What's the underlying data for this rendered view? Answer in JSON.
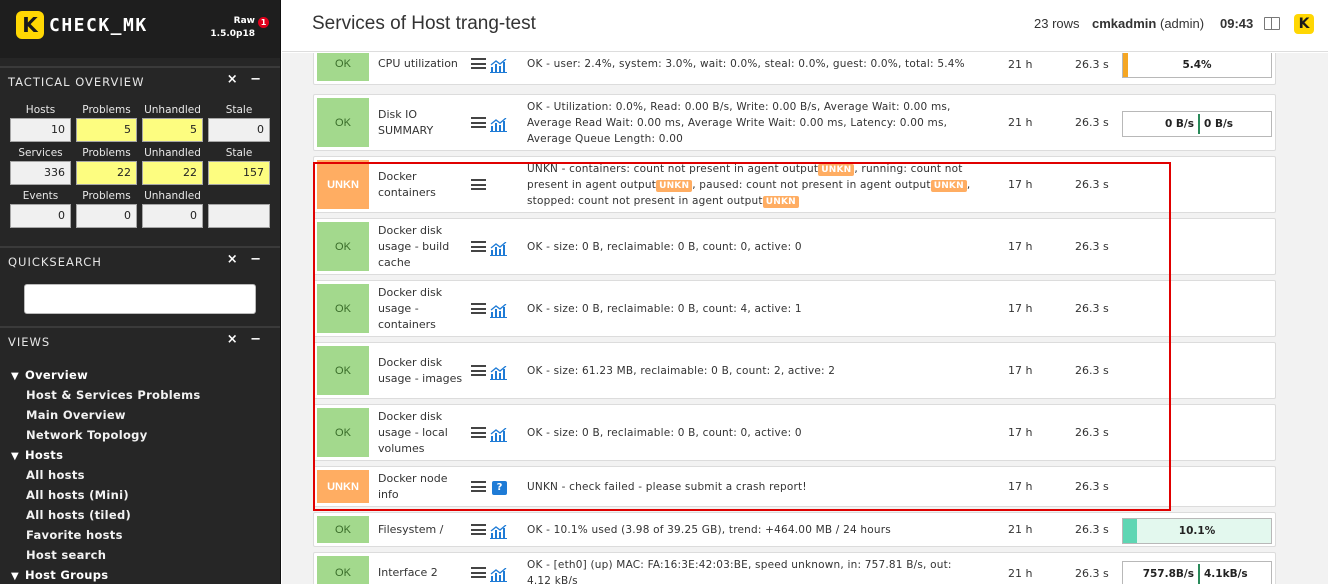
{
  "brand": {
    "logo_letter": "K",
    "name": "CHECK_MK",
    "edition": "Raw",
    "version": "1.5.0p18",
    "badge": "1"
  },
  "tactical": {
    "title": "TACTICAL OVERVIEW",
    "controls": "× −",
    "rows": [
      {
        "headers": [
          "Hosts",
          "Problems",
          "Unhandled",
          "Stale"
        ],
        "values": [
          "10",
          "5",
          "5",
          "0"
        ]
      },
      {
        "headers": [
          "Services",
          "Problems",
          "Unhandled",
          "Stale"
        ],
        "values": [
          "336",
          "22",
          "22",
          "157"
        ]
      },
      {
        "headers": [
          "Events",
          "Problems",
          "Unhandled",
          ""
        ],
        "values": [
          "0",
          "0",
          "0",
          ""
        ]
      }
    ]
  },
  "quicksearch": {
    "title": "QUICKSEARCH",
    "controls": "× −",
    "value": ""
  },
  "views": {
    "title": "VIEWS",
    "controls": "× −",
    "items": [
      {
        "label": "Overview",
        "level": "top"
      },
      {
        "label": "Host & Services Problems",
        "level": "sub"
      },
      {
        "label": "Main Overview",
        "level": "sub"
      },
      {
        "label": "Network Topology",
        "level": "sub"
      },
      {
        "label": "Hosts",
        "level": "top"
      },
      {
        "label": "All hosts",
        "level": "sub"
      },
      {
        "label": "All hosts (Mini)",
        "level": "sub"
      },
      {
        "label": "All hosts (tiled)",
        "level": "sub"
      },
      {
        "label": "Favorite hosts",
        "level": "sub"
      },
      {
        "label": "Host search",
        "level": "sub"
      },
      {
        "label": "Host Groups",
        "level": "top"
      }
    ]
  },
  "header": {
    "title": "Services of Host trang-test",
    "rows": "23 rows",
    "user": "cmkadmin",
    "role": "(admin)",
    "time": "09:43"
  },
  "services": [
    {
      "state": "OK",
      "name": "CPU utilization",
      "output": "OK - user: 2.4%, system: 3.0%, wait: 0.0%, steal: 0.0%, guest: 0.0%, total: 5.4%",
      "age": "21 h",
      "check": "26.3 s",
      "perf": "5.4%",
      "perf_pct": 5.4,
      "icon": "graph"
    },
    {
      "state": "OK",
      "name": "Disk IO SUMMARY",
      "output": "OK - Utilization: 0.0%, Read: 0.00 B/s, Write: 0.00 B/s, Average Wait: 0.00 ms, Average Read Wait: 0.00 ms, Average Write Wait: 0.00 ms, Latency: 0.00 ms, Average Queue Length: 0.00",
      "age": "21 h",
      "check": "26.3 s",
      "perf_left": "0 B/s",
      "perf_right": "0 B/s",
      "icon": "graph"
    },
    {
      "state": "UNKN",
      "name": "Docker containers",
      "output_parts": [
        "UNKN - containers: count not present in agent output",
        ", running: count not present in agent output",
        ", paused: count not present in agent output",
        ", stopped: count not present in agent output"
      ],
      "tag": "UNKN",
      "age": "17 h",
      "check": "26.3 s",
      "icon": "none"
    },
    {
      "state": "OK",
      "name": "Docker disk usage - build cache",
      "output": "OK - size: 0 B, reclaimable: 0 B, count: 0, active: 0",
      "age": "17 h",
      "check": "26.3 s",
      "icon": "graph"
    },
    {
      "state": "OK",
      "name": "Docker disk usage - containers",
      "output": "OK - size: 0 B, reclaimable: 0 B, count: 4, active: 1",
      "age": "17 h",
      "check": "26.3 s",
      "icon": "graph"
    },
    {
      "state": "OK",
      "name": "Docker disk usage - images",
      "output": "OK - size: 61.23 MB, reclaimable: 0 B, count: 2, active: 2",
      "age": "17 h",
      "check": "26.3 s",
      "icon": "graph"
    },
    {
      "state": "OK",
      "name": "Docker disk usage - local volumes",
      "output": "OK - size: 0 B, reclaimable: 0 B, count: 0, active: 0",
      "age": "17 h",
      "check": "26.3 s",
      "icon": "graph"
    },
    {
      "state": "UNKN",
      "name": "Docker node info",
      "output": "UNKN - check failed - please submit a crash report!",
      "age": "17 h",
      "check": "26.3 s",
      "icon": "help"
    },
    {
      "state": "OK",
      "name": "Filesystem /",
      "output": "OK - 10.1% used (3.98 of 39.25 GB), trend: +464.00 MB / 24 hours",
      "age": "21 h",
      "check": "26.3 s",
      "perf": "10.1%",
      "perf_pct": 10.1,
      "icon": "graph"
    },
    {
      "state": "OK",
      "name": "Interface 2",
      "output": "OK - [eth0] (up) MAC: FA:16:3E:42:03:BE, speed unknown, in: 757.81 B/s, out: 4.12 kB/s",
      "age": "21 h",
      "check": "26.3 s",
      "perf_left": "757.8B/s",
      "perf_right": "4.1kB/s",
      "icon": "graph"
    }
  ],
  "colors": {
    "ok": "#a3d98d",
    "unkn": "#ffad62",
    "highlight": "#e00000",
    "sidebar": "#262626",
    "brand": "#ffd703"
  }
}
